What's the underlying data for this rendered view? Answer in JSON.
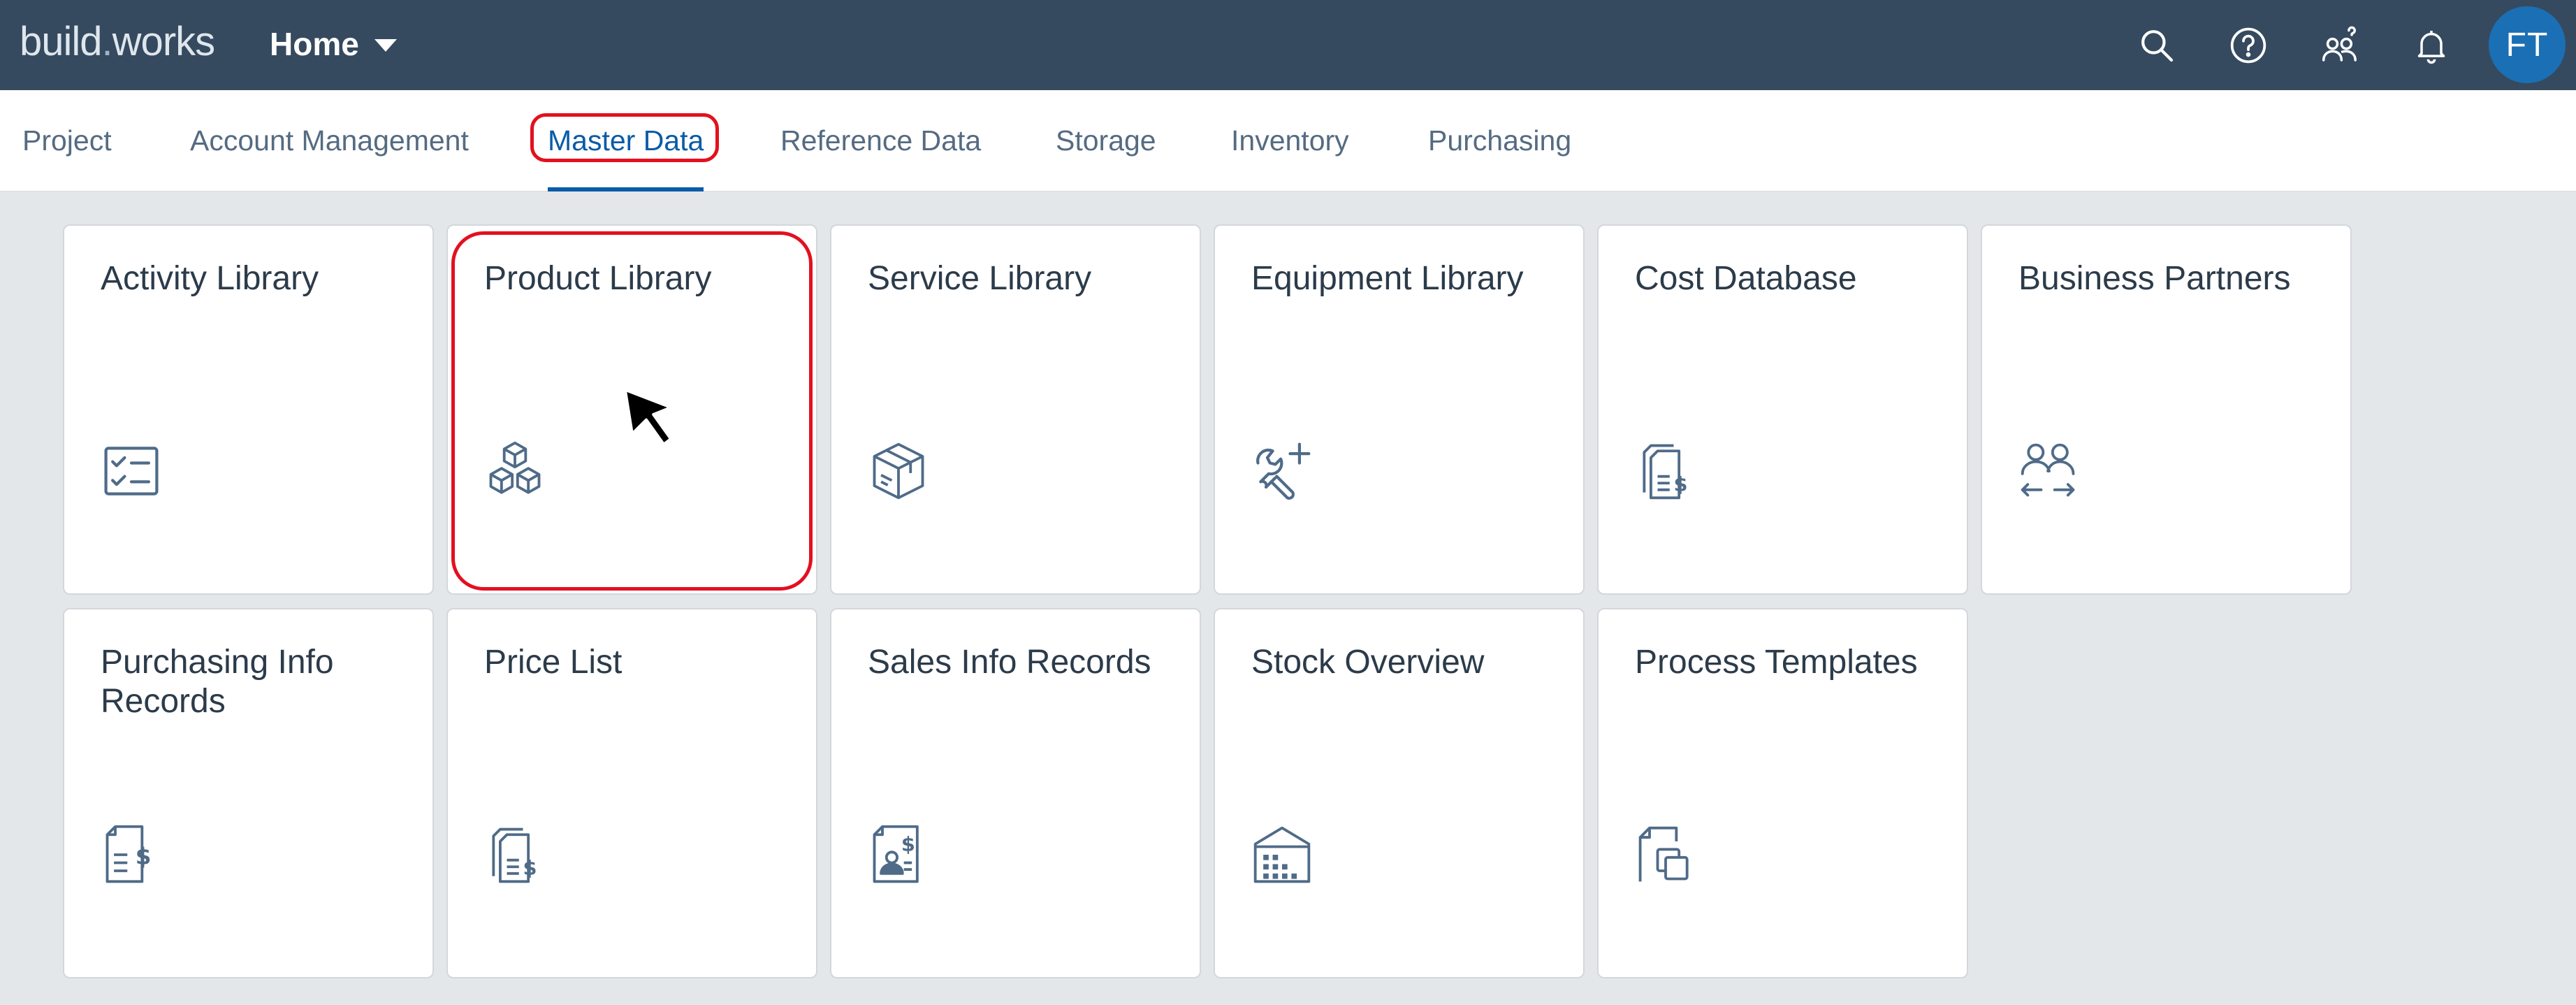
{
  "shell": {
    "logo_part1": "build",
    "logo_dot": ".",
    "logo_part2": "works",
    "home_label": "Home",
    "home_caret_icon": "caret-down-icon",
    "icons": [
      "search-icon",
      "help-icon",
      "people-icon",
      "bell-icon"
    ],
    "avatar_initials": "FT"
  },
  "tabs": [
    {
      "label": "Project"
    },
    {
      "label": "Account Management"
    },
    {
      "label": "Master Data",
      "active": true
    },
    {
      "label": "Reference Data"
    },
    {
      "label": "Storage"
    },
    {
      "label": "Inventory"
    },
    {
      "label": "Purchasing"
    }
  ],
  "tiles": [
    {
      "title": "Activity Library",
      "icon": "checklist-icon"
    },
    {
      "title": "Product Library",
      "icon": "product-cubes-icon",
      "highlighted": true
    },
    {
      "title": "Service Library",
      "icon": "service-box-icon"
    },
    {
      "title": "Equipment Library",
      "icon": "wrench-add-icon"
    },
    {
      "title": "Cost Database",
      "icon": "documents-dollar-icon"
    },
    {
      "title": "Business Partners",
      "icon": "partners-exchange-icon"
    },
    {
      "title": "Purchasing Info Records",
      "icon": "document-dollar-icon"
    },
    {
      "title": "Price List",
      "icon": "price-list-icon"
    },
    {
      "title": "Sales Info Records",
      "icon": "sales-record-icon"
    },
    {
      "title": "Stock Overview",
      "icon": "warehouse-icon"
    },
    {
      "title": "Process Templates",
      "icon": "document-copy-icon"
    }
  ],
  "colors": {
    "shell_bg": "#354a5f",
    "active_tab": "#0a5ba8",
    "highlight": "#e3101f",
    "icon": "#4f6b88",
    "avatar": "#1b6fb5"
  }
}
